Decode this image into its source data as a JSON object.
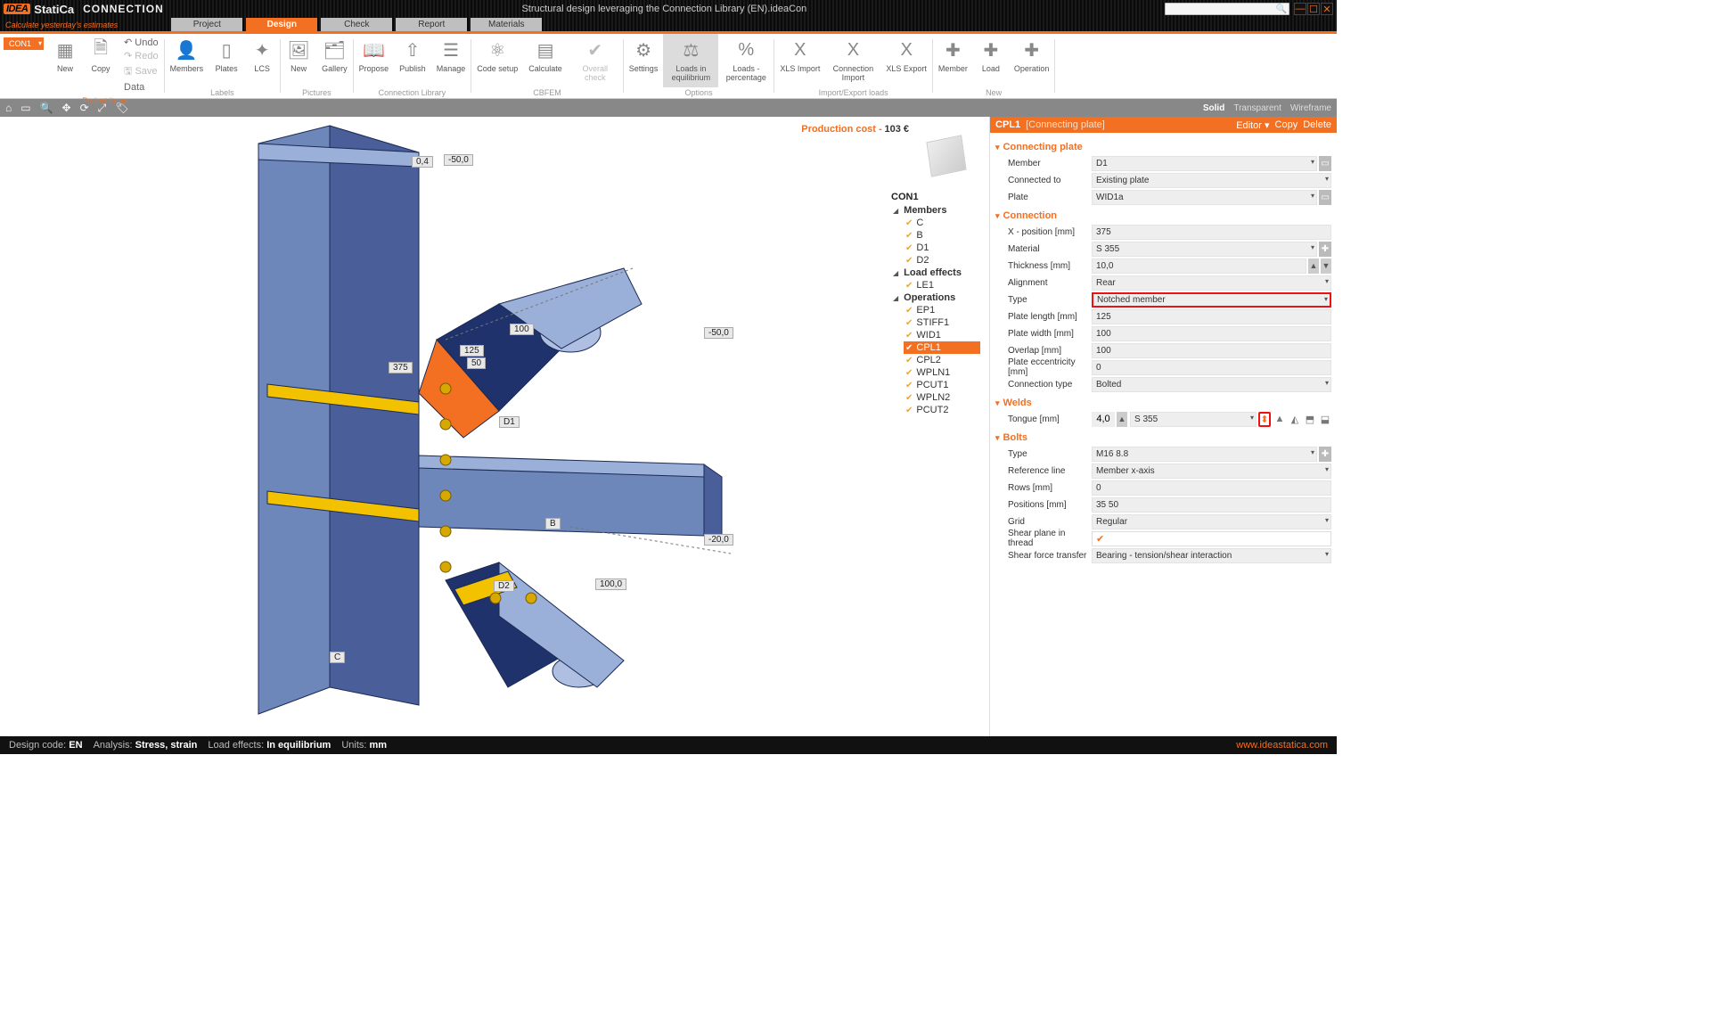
{
  "title": {
    "brand": "IDEA",
    "brand2": "StatiCa",
    "product": "CONNECTION",
    "document": "Structural design leveraging the Connection Library (EN).ideaCon",
    "tagline": "Calculate yesterday's estimates"
  },
  "tabs": [
    "Project",
    "Design",
    "Check",
    "Report",
    "Materials"
  ],
  "active_tab": 1,
  "con_chip": "CON1",
  "ribbon": {
    "groups": [
      {
        "label": "Project items",
        "hl": true,
        "row": [
          {
            "icon": "ic-cube",
            "label": "New"
          },
          {
            "icon": "ic-page",
            "label": "Copy"
          }
        ],
        "side": [
          {
            "t": "↶ Undo"
          },
          {
            "t": "↷ Redo",
            "dis": true
          },
          {
            "t": "🖫 Save",
            "dis": true
          },
          {
            "t": "Data"
          }
        ]
      },
      {
        "label": "Labels",
        "row": [
          {
            "icon": "ic-user",
            "label": "Members"
          },
          {
            "icon": "ic-plate",
            "label": "Plates"
          },
          {
            "icon": "ic-axes",
            "label": "LCS"
          }
        ]
      },
      {
        "label": "Pictures",
        "row": [
          {
            "icon": "ic-img",
            "label": "New"
          },
          {
            "icon": "ic-gallery",
            "label": "Gallery"
          }
        ]
      },
      {
        "label": "Connection Library",
        "row": [
          {
            "icon": "ic-book",
            "label": "Propose"
          },
          {
            "icon": "ic-upload",
            "label": "Publish"
          },
          {
            "icon": "ic-mgmt",
            "label": "Manage"
          }
        ]
      },
      {
        "label": "CBFEM",
        "row": [
          {
            "icon": "ic-code",
            "label": "Code setup"
          },
          {
            "icon": "ic-calc",
            "label": "Calculate"
          },
          {
            "icon": "ic-check",
            "label": "Overall check",
            "dis": true
          }
        ]
      },
      {
        "label": "Options",
        "row": [
          {
            "icon": "ic-gear",
            "label": "Settings"
          },
          {
            "icon": "ic-scale",
            "label": "Loads in equilibrium",
            "hl": true
          },
          {
            "icon": "ic-pct",
            "label": "Loads - percentage"
          }
        ]
      },
      {
        "label": "Import/Export loads",
        "row": [
          {
            "icon": "ic-xls",
            "label": "XLS Import"
          },
          {
            "icon": "ic-xls",
            "label": "Connection Import"
          },
          {
            "icon": "ic-xls",
            "label": "XLS Export"
          }
        ]
      },
      {
        "label": "New",
        "row": [
          {
            "icon": "ic-plus",
            "label": "Member"
          },
          {
            "icon": "ic-plus",
            "label": "Load"
          },
          {
            "icon": "ic-plus",
            "label": "Operation"
          }
        ]
      }
    ]
  },
  "viewmodes": [
    "Solid",
    "Transparent",
    "Wireframe"
  ],
  "active_viewmode": 0,
  "cost_label": "Production cost  -",
  "cost_value": "103 €",
  "tree": {
    "root": "CON1",
    "groups": [
      {
        "name": "Members",
        "items": [
          "C",
          "B",
          "D1",
          "D2"
        ]
      },
      {
        "name": "Load effects",
        "items": [
          "LE1"
        ]
      },
      {
        "name": "Operations",
        "items": [
          "EP1",
          "STIFF1",
          "WID1",
          "CPL1",
          "CPL2",
          "WPLN1",
          "PCUT1",
          "WPLN2",
          "PCUT2"
        ],
        "selected": "CPL1"
      }
    ]
  },
  "model_labels": {
    "C": "C",
    "B": "B",
    "D1": "D1",
    "D2": "D2",
    "d375": "375",
    "d125": "125",
    "d50": "50",
    "dn50": "-50,0",
    "dn20": "-20,0",
    "d100": "100",
    "d100b": "100,0",
    "d04": "0,4"
  },
  "rpanel": {
    "header": {
      "name": "CPL1",
      "sub": "[Connecting plate]",
      "editor": "Editor ▾",
      "copy": "Copy",
      "delete": "Delete"
    },
    "sections": {
      "connecting_plate": {
        "title": "Connecting plate",
        "rows": [
          {
            "l": "Member",
            "v": "D1",
            "dd": true,
            "pick": true
          },
          {
            "l": "Connected to",
            "v": "Existing plate",
            "dd": true
          },
          {
            "l": "Plate",
            "v": "WID1a",
            "dd": true,
            "pick": true
          }
        ]
      },
      "connection": {
        "title": "Connection",
        "rows": [
          {
            "l": "X - position [mm]",
            "v": "375"
          },
          {
            "l": "Material",
            "v": "S 355",
            "dd": true,
            "plus": true
          },
          {
            "l": "Thickness [mm]",
            "v": "10,0",
            "step": true
          },
          {
            "l": "Alignment",
            "v": "Rear",
            "dd": true
          },
          {
            "l": "Type",
            "v": "Notched member",
            "dd": true,
            "red": true
          },
          {
            "l": "Plate length [mm]",
            "v": "125"
          },
          {
            "l": "Plate width [mm]",
            "v": "100"
          },
          {
            "l": "Overlap [mm]",
            "v": "100"
          },
          {
            "l": "Plate eccentricity [mm]",
            "v": "0"
          },
          {
            "l": "Connection type",
            "v": "Bolted",
            "dd": true
          }
        ]
      },
      "welds": {
        "title": "Welds",
        "rows": [
          {
            "l": "Tongue [mm]",
            "v1": "4,0",
            "v2": "S 355",
            "dd": true,
            "weldtools": true
          }
        ]
      },
      "bolts": {
        "title": "Bolts",
        "rows": [
          {
            "l": "Type",
            "v": "M16 8.8",
            "dd": true,
            "plus": true
          },
          {
            "l": "Reference line",
            "v": "Member x-axis",
            "dd": true
          },
          {
            "l": "Rows [mm]",
            "v": "0"
          },
          {
            "l": "Positions [mm]",
            "v": "35 50"
          },
          {
            "l": "Grid",
            "v": "Regular",
            "dd": true
          },
          {
            "l": "Shear plane in thread",
            "v": "✓",
            "check": true
          },
          {
            "l": "Shear force transfer",
            "v": "Bearing - tension/shear interaction",
            "dd": true
          }
        ]
      }
    }
  },
  "status": {
    "design_code_l": "Design code:",
    "design_code": "EN",
    "analysis_l": "Analysis:",
    "analysis": "Stress, strain",
    "loads_l": "Load effects:",
    "loads": "In equilibrium",
    "units_l": "Units:",
    "units": "mm",
    "site": "www.ideastatica.com"
  }
}
